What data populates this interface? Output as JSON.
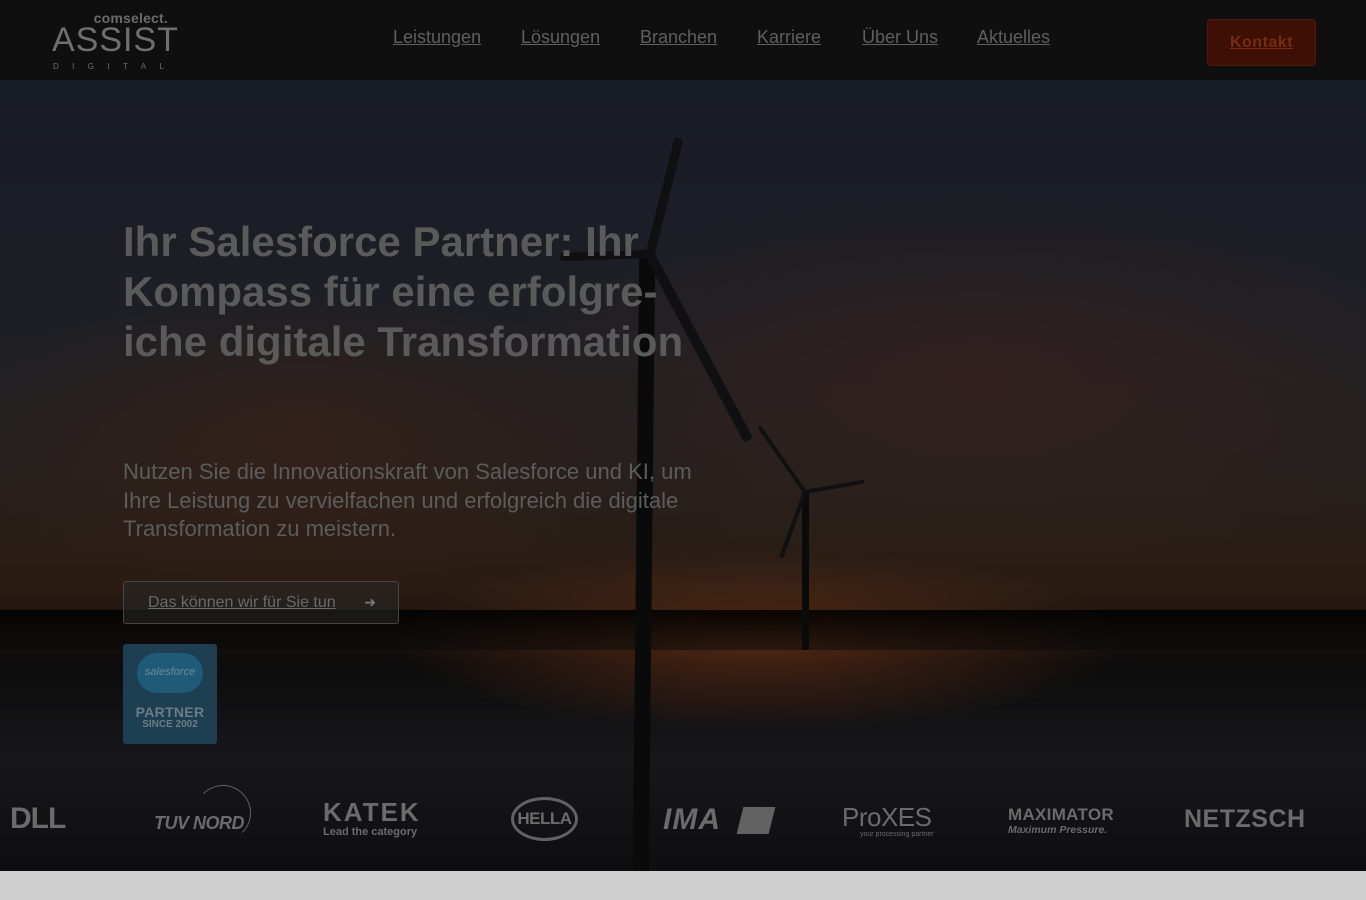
{
  "header": {
    "logo": {
      "top": "comselect.",
      "main": "ASSIST",
      "sub": "DIGITAL"
    },
    "nav": [
      {
        "label": "Leistungen"
      },
      {
        "label": "Lösungen"
      },
      {
        "label": "Branchen"
      },
      {
        "label": "Karriere"
      },
      {
        "label": "Über Uns"
      },
      {
        "label": "Aktuelles"
      }
    ],
    "contact_label": "Kontakt"
  },
  "hero": {
    "title": "Ihr Salesforce Partner: Ihr Kompass für eine erfolgre­iche digitale Transformation",
    "subtitle": "Nutzen Sie die Innovationskraft von Salesforce und KI, um Ihre Leistung zu vervielfachen und erfolgreich die digitale Transformation zu meistern.",
    "cta_label": "Das können wir für Sie tun",
    "cta_icon": "arrow-right-icon",
    "badge": {
      "brand": "salesforce",
      "line1": "PARTNER",
      "line2": "SINCE 2002"
    }
  },
  "clients": [
    {
      "name": "DELL",
      "visible_text": "DLL"
    },
    {
      "name": "TÜV NORD",
      "visible_text": "TUV NORD"
    },
    {
      "name": "KATEK",
      "visible_text": "KATEK",
      "tagline": "Lead the category"
    },
    {
      "name": "HELLA",
      "visible_text": "HELLA"
    },
    {
      "name": "IMA",
      "visible_text": "IMA"
    },
    {
      "name": "ProXES",
      "visible_text": "ProXES",
      "tagline": "your processing partner"
    },
    {
      "name": "MAXIMATOR",
      "visible_text": "MAXIMATOR",
      "tagline": "Maximum Pressure."
    },
    {
      "name": "NETZSCH",
      "visible_text": "NETZSCH"
    }
  ],
  "colors": {
    "header_bg": "#0f0f0f",
    "contact_button_bg": "#3d0f05",
    "badge_bg": "#1e3e52",
    "text_dimmed": "#5a5a5a"
  }
}
